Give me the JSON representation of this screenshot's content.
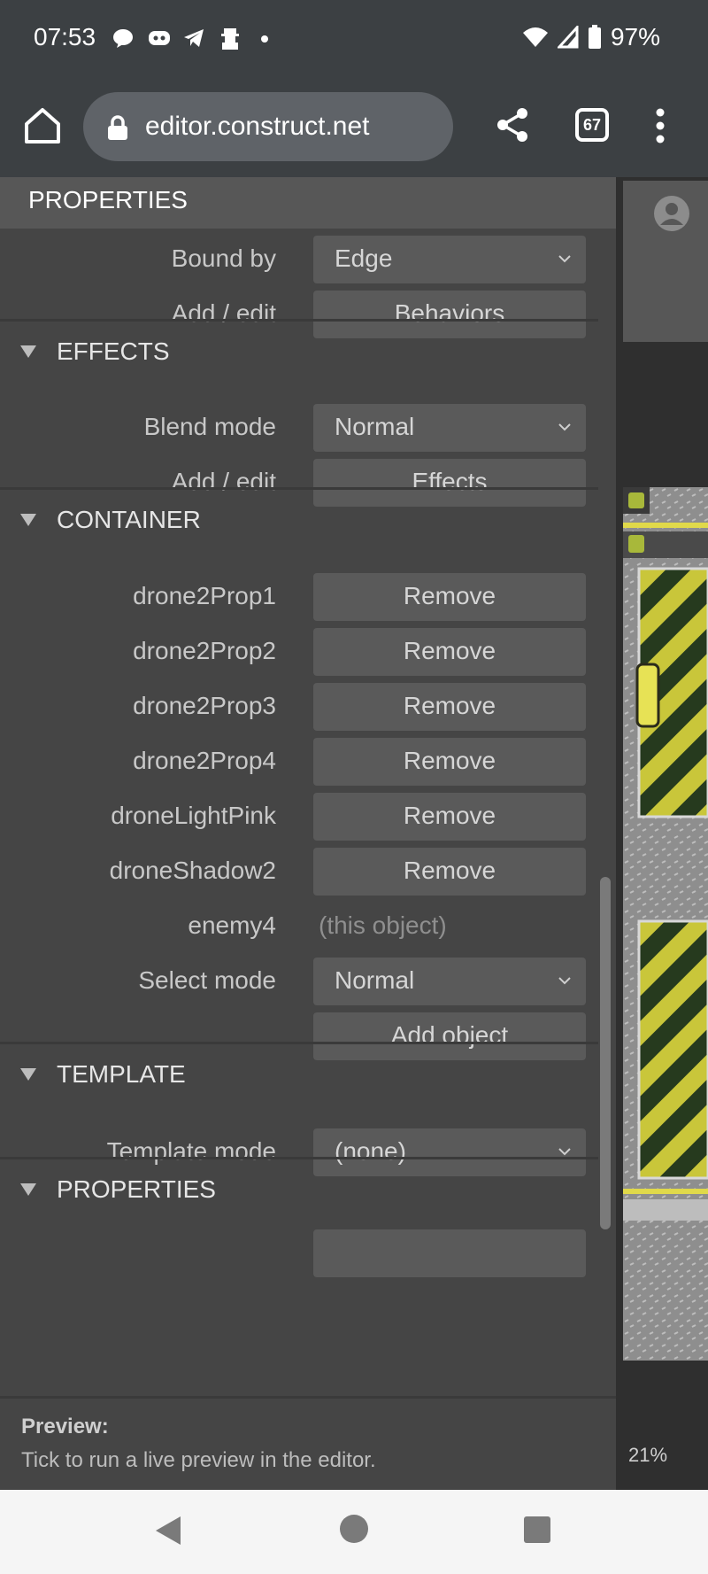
{
  "status_bar": {
    "time": "07:53",
    "battery": "97%",
    "icons": [
      "chat-bubble-icon",
      "discord-icon",
      "telegram-icon",
      "character-icon",
      "dot-icon"
    ]
  },
  "browser": {
    "url": "editor.construct.net",
    "tab_count": "67"
  },
  "panel": {
    "header": "PROPERTIES",
    "rows_top": [
      {
        "label": "Bound by",
        "value": "Edge",
        "type": "select"
      },
      {
        "label": "Add / edit",
        "value": "Behaviors",
        "type": "button"
      }
    ],
    "effects": {
      "title": "EFFECTS",
      "rows": [
        {
          "label": "Blend mode",
          "value": "Normal",
          "type": "select"
        },
        {
          "label": "Add / edit",
          "value": "Effects",
          "type": "button"
        }
      ]
    },
    "container": {
      "title": "CONTAINER",
      "rows": [
        {
          "label": "drone2Prop1",
          "value": "Remove"
        },
        {
          "label": "drone2Prop2",
          "value": "Remove"
        },
        {
          "label": "drone2Prop3",
          "value": "Remove"
        },
        {
          "label": "drone2Prop4",
          "value": "Remove"
        },
        {
          "label": "droneLightPink",
          "value": "Remove"
        },
        {
          "label": "droneShadow2",
          "value": "Remove"
        }
      ],
      "this_object": {
        "label": "enemy4",
        "value": "(this object)"
      },
      "select_mode": {
        "label": "Select mode",
        "value": "Normal"
      },
      "add_object": "Add object"
    },
    "template": {
      "title": "TEMPLATE",
      "row": {
        "label": "Template mode",
        "value": "(none)"
      }
    },
    "properties2": {
      "title": "PROPERTIES"
    },
    "preview": {
      "title": "Preview:",
      "text": "Tick to run a live preview in the editor."
    }
  },
  "view": {
    "zoom": "21%"
  },
  "colors": {
    "panel_bg": "#454545",
    "header_bg": "#575757",
    "control_bg": "#5a5a5a",
    "browser_bar": "#3c4043",
    "hazard_yellow": "#c9c63a",
    "hazard_dark": "#263a1e"
  }
}
